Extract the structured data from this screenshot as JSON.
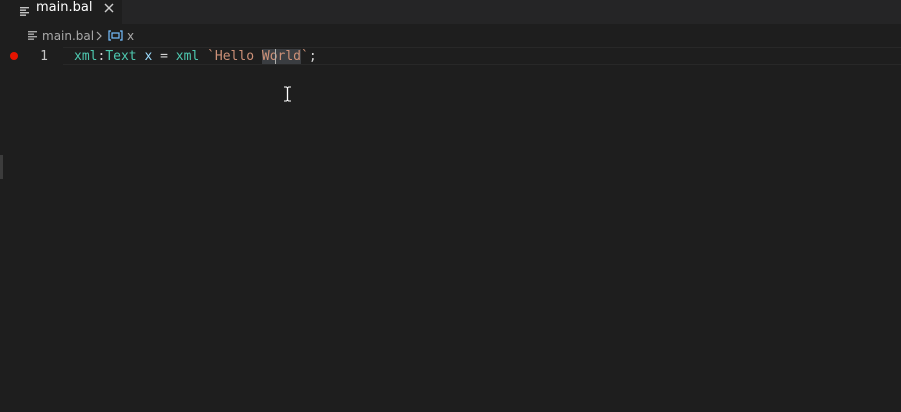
{
  "tab": {
    "filename": "main.bal",
    "close_icon": "close-icon",
    "file_icon": "file-lines-icon"
  },
  "breadcrumb": {
    "file": "main.bal",
    "separator_icon": "chevron-right-icon",
    "symbol_icon": "variable-icon",
    "symbol": "x"
  },
  "editor": {
    "line_number": "1",
    "breakpoint_color": "#e51400",
    "code": {
      "t1": "xml",
      "t2": ":",
      "t3": "Text",
      "t4": " ",
      "t5": "x",
      "t6": " = ",
      "t7": "xml",
      "t8": " ",
      "t9": "`Hello ",
      "t10": "World",
      "t11": "`",
      "t12": ";"
    }
  },
  "colors": {
    "background": "#1e1e1e",
    "tabbar": "#252526",
    "type": "#4ec9b0",
    "string": "#ce9178",
    "variable": "#9cdcfe"
  }
}
